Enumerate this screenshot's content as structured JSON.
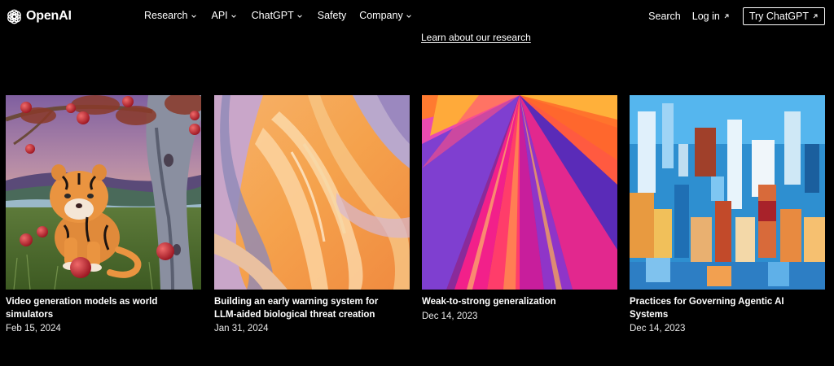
{
  "header": {
    "logo_text": "OpenAI",
    "nav": [
      {
        "label": "Research",
        "dropdown": true
      },
      {
        "label": "API",
        "dropdown": true
      },
      {
        "label": "ChatGPT",
        "dropdown": true
      },
      {
        "label": "Safety",
        "dropdown": false
      },
      {
        "label": "Company",
        "dropdown": true
      }
    ],
    "search_label": "Search",
    "login_label": "Log in",
    "try_label": "Try ChatGPT"
  },
  "hero": {
    "research_link": "Learn about our research"
  },
  "cards": [
    {
      "title": "Video generation models as world simulators",
      "date": "Feb 15, 2024",
      "image": "tiger-cub-apple-tree-painting"
    },
    {
      "title": "Building an early warning system for LLM-aided biological threat creation",
      "date": "Jan 31, 2024",
      "image": "orange-lavender-swirl-abstract"
    },
    {
      "title": "Weak-to-strong generalization",
      "date": "Dec 14, 2023",
      "image": "magenta-orange-rays-abstract"
    },
    {
      "title": "Practices for Governing Agentic AI Systems",
      "date": "Dec 14, 2023",
      "image": "blue-orange-brushstroke-abstract"
    }
  ],
  "colors": {
    "background": "#000000",
    "text": "#ffffff"
  },
  "icons": [
    "openai-logo-icon",
    "chevron-down-icon",
    "arrow-up-right-icon"
  ]
}
